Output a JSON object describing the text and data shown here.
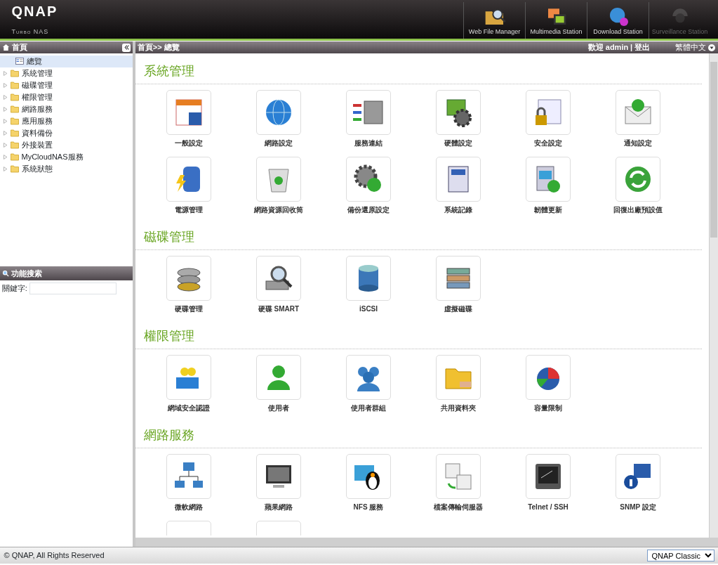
{
  "header": {
    "logo": "QNAP",
    "subtitle": "Turbo NAS",
    "stations": [
      {
        "label": "Web File Manager",
        "disabled": false
      },
      {
        "label": "Multimedia Station",
        "disabled": false
      },
      {
        "label": "Download Station",
        "disabled": false
      },
      {
        "label": "Surveillance Station",
        "disabled": true
      }
    ]
  },
  "sidebar": {
    "title": "首頁",
    "items": [
      {
        "label": "總覽",
        "kind": "page",
        "selected": true
      },
      {
        "label": "系統管理",
        "kind": "folder",
        "selected": false,
        "expanded": false
      },
      {
        "label": "磁碟管理",
        "kind": "folder",
        "selected": false,
        "expanded": false
      },
      {
        "label": "權限管理",
        "kind": "folder",
        "selected": false,
        "expanded": false
      },
      {
        "label": "網路服務",
        "kind": "folder",
        "selected": false,
        "expanded": false
      },
      {
        "label": "應用服務",
        "kind": "folder",
        "selected": false,
        "expanded": false
      },
      {
        "label": "資料備份",
        "kind": "folder",
        "selected": false,
        "expanded": false
      },
      {
        "label": "外接裝置",
        "kind": "folder",
        "selected": false,
        "expanded": false
      },
      {
        "label": "MyCloudNAS服務",
        "kind": "folder",
        "selected": false,
        "expanded": false
      },
      {
        "label": "系統狀態",
        "kind": "folder",
        "selected": false,
        "expanded": false
      }
    ],
    "search": {
      "title": "功能搜索",
      "label": "關鍵字:"
    }
  },
  "breadcrumb": "首頁>> 總覽",
  "user": {
    "welcome": "歡迎 admin",
    "separator": "|",
    "logout": "登出"
  },
  "language": "繁體中文",
  "sections": [
    {
      "title": "系統管理",
      "items": [
        {
          "label": "一般設定",
          "kind": "app"
        },
        {
          "label": "網路設定",
          "kind": "app"
        },
        {
          "label": "服務連結",
          "kind": "app"
        },
        {
          "label": "硬體設定",
          "kind": "app"
        },
        {
          "label": "安全設定",
          "kind": "app"
        },
        {
          "label": "通知設定",
          "kind": "app"
        },
        {
          "label": "電源管理",
          "kind": "app"
        },
        {
          "label": "網路資源回收筒",
          "kind": "app"
        },
        {
          "label": "備份還原設定",
          "kind": "app"
        },
        {
          "label": "系統記錄",
          "kind": "app"
        },
        {
          "label": "韌體更新",
          "kind": "app"
        },
        {
          "label": "回復出廠預設值",
          "kind": "app"
        }
      ]
    },
    {
      "title": "磁碟管理",
      "items": [
        {
          "label": "硬碟管理",
          "kind": "app"
        },
        {
          "label": "硬碟 SMART",
          "kind": "app"
        },
        {
          "label": "iSCSI",
          "kind": "app"
        },
        {
          "label": "虛擬磁碟",
          "kind": "app"
        }
      ]
    },
    {
      "title": "權限管理",
      "items": [
        {
          "label": "網域安全認證",
          "kind": "app"
        },
        {
          "label": "使用者",
          "kind": "app"
        },
        {
          "label": "使用者群組",
          "kind": "app"
        },
        {
          "label": "共用資料夾",
          "kind": "app"
        },
        {
          "label": "容量限制",
          "kind": "app"
        }
      ]
    },
    {
      "title": "網路服務",
      "items": [
        {
          "label": "微軟網路",
          "kind": "app"
        },
        {
          "label": "蘋果網路",
          "kind": "app"
        },
        {
          "label": "NFS 服務",
          "kind": "app"
        },
        {
          "label": "檔案傳輸伺服器",
          "kind": "app"
        },
        {
          "label": "Telnet / SSH",
          "kind": "app"
        },
        {
          "label": "SNMP 設定",
          "kind": "app"
        },
        {
          "kind": "partial"
        },
        {
          "kind": "partial"
        }
      ]
    }
  ],
  "footer": {
    "copyright": "© QNAP, All Rights Reserved",
    "theme": "QNAP Classic"
  }
}
